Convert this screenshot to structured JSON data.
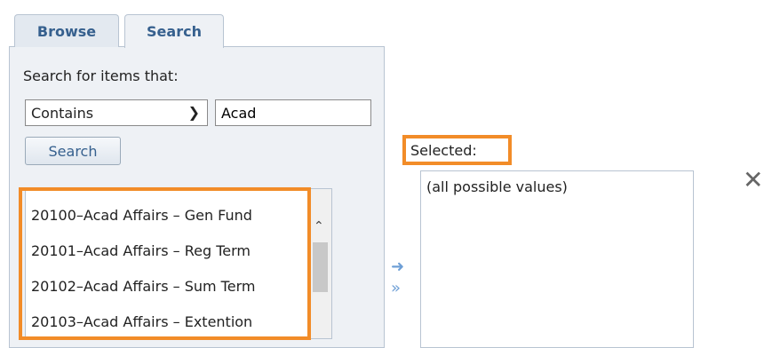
{
  "tabs": [
    {
      "label": "Browse"
    },
    {
      "label": "Search"
    }
  ],
  "search": {
    "label": "Search for items that:",
    "operator": "Contains",
    "query": "Acad",
    "button_label": "Search"
  },
  "results": [
    "20100–Acad Affairs – Gen Fund",
    "20101–Acad Affairs – Reg Term",
    "20102–Acad Affairs – Sum Term",
    "20103–Acad Affairs – Extention"
  ],
  "selected": {
    "label": "Selected:",
    "value": "(all possible values)"
  },
  "icons": {
    "move_one": "arrow-right-icon",
    "move_all": "double-arrow-right-icon",
    "clear": "close-icon",
    "dropdown": "chevron-down-icon",
    "scroll_up": "scroll-up-icon"
  },
  "colors": {
    "highlight": "#f28c28",
    "tab_text": "#36608e",
    "panel_bg": "#eef1f5",
    "arrow": "#6e9fd6"
  }
}
